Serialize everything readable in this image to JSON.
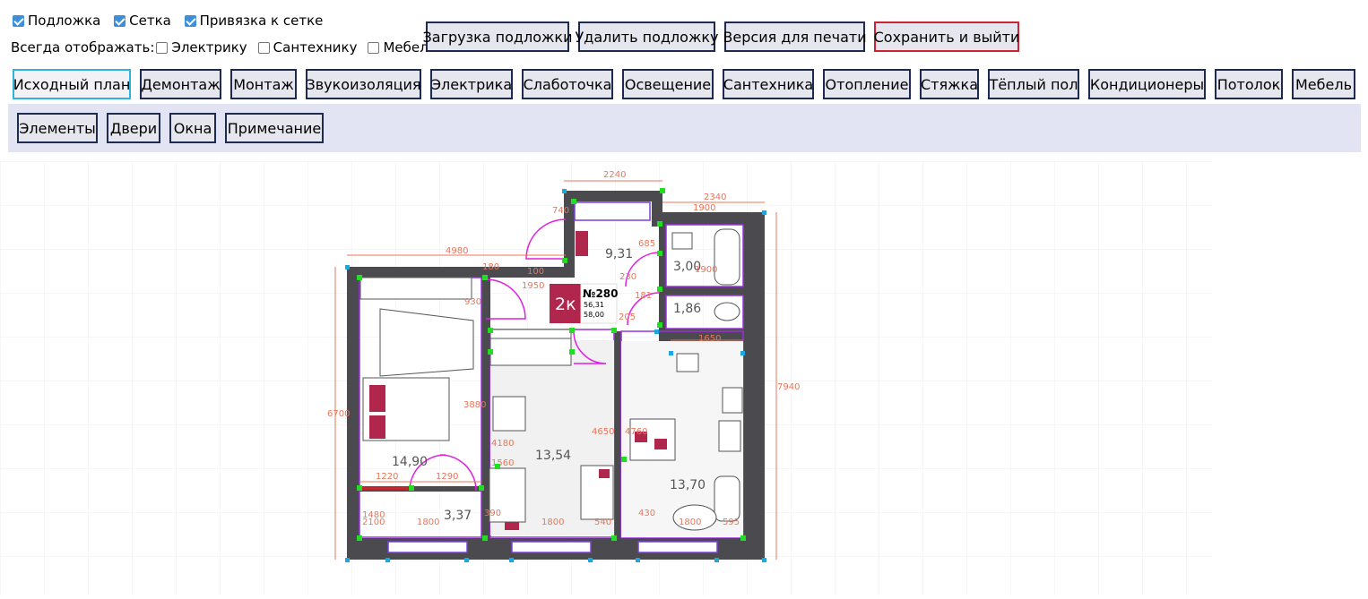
{
  "toggles": {
    "underlay": {
      "label": "Подложка",
      "checked": true
    },
    "grid": {
      "label": "Сетка",
      "checked": true
    },
    "snap": {
      "label": "Привязка к сетке",
      "checked": true
    }
  },
  "always_show": {
    "label": "Всегда отображать:",
    "electrics": {
      "label": "Электрику",
      "checked": false
    },
    "plumbing": {
      "label": "Сантехнику",
      "checked": false
    },
    "furniture": {
      "label": "Мебель",
      "checked": false
    }
  },
  "actions": {
    "load_underlay": "Загрузка подложки",
    "delete_underlay": "Удалить подложку",
    "print_version": "Версия для печати",
    "save_exit": "Сохранить и выйти"
  },
  "tabs": [
    "Исходный план",
    "Демонтаж",
    "Монтаж",
    "Звукоизоляция",
    "Электрика",
    "Слаботочка",
    "Освещение",
    "Сантехника",
    "Отопление",
    "Стяжка",
    "Тёплый пол",
    "Кондиционеры",
    "Потолок",
    "Мебель"
  ],
  "active_tab": "Исходный план",
  "subtools": [
    "Элементы",
    "Двери",
    "Окна",
    "Примечание"
  ],
  "plan": {
    "badge": "2к",
    "number": "№280",
    "area1": "56,31",
    "area2": "58,00",
    "rooms": [
      "9,31",
      "3,00",
      "1,86",
      "14,90",
      "13,54",
      "13,70",
      "3,37"
    ],
    "dims": [
      "2240",
      "2340",
      "1900",
      "740",
      "685",
      "4980",
      "100",
      "180",
      "1950",
      "930",
      "230",
      "1900",
      "181",
      "205",
      "1650",
      "7940",
      "6700",
      "3880",
      "4180",
      "4650",
      "4760",
      "1220",
      "1290",
      "1800",
      "1800",
      "1800",
      "430",
      "595",
      "390",
      "1480",
      "540",
      "2100",
      "1560"
    ]
  },
  "colors": {
    "accent": "#2fb4e0",
    "danger": "#cc2233",
    "panel": "#e2e3f3",
    "wall": "#4a4a4f",
    "dim": "#e8765a",
    "axis": "#9b30d8"
  }
}
